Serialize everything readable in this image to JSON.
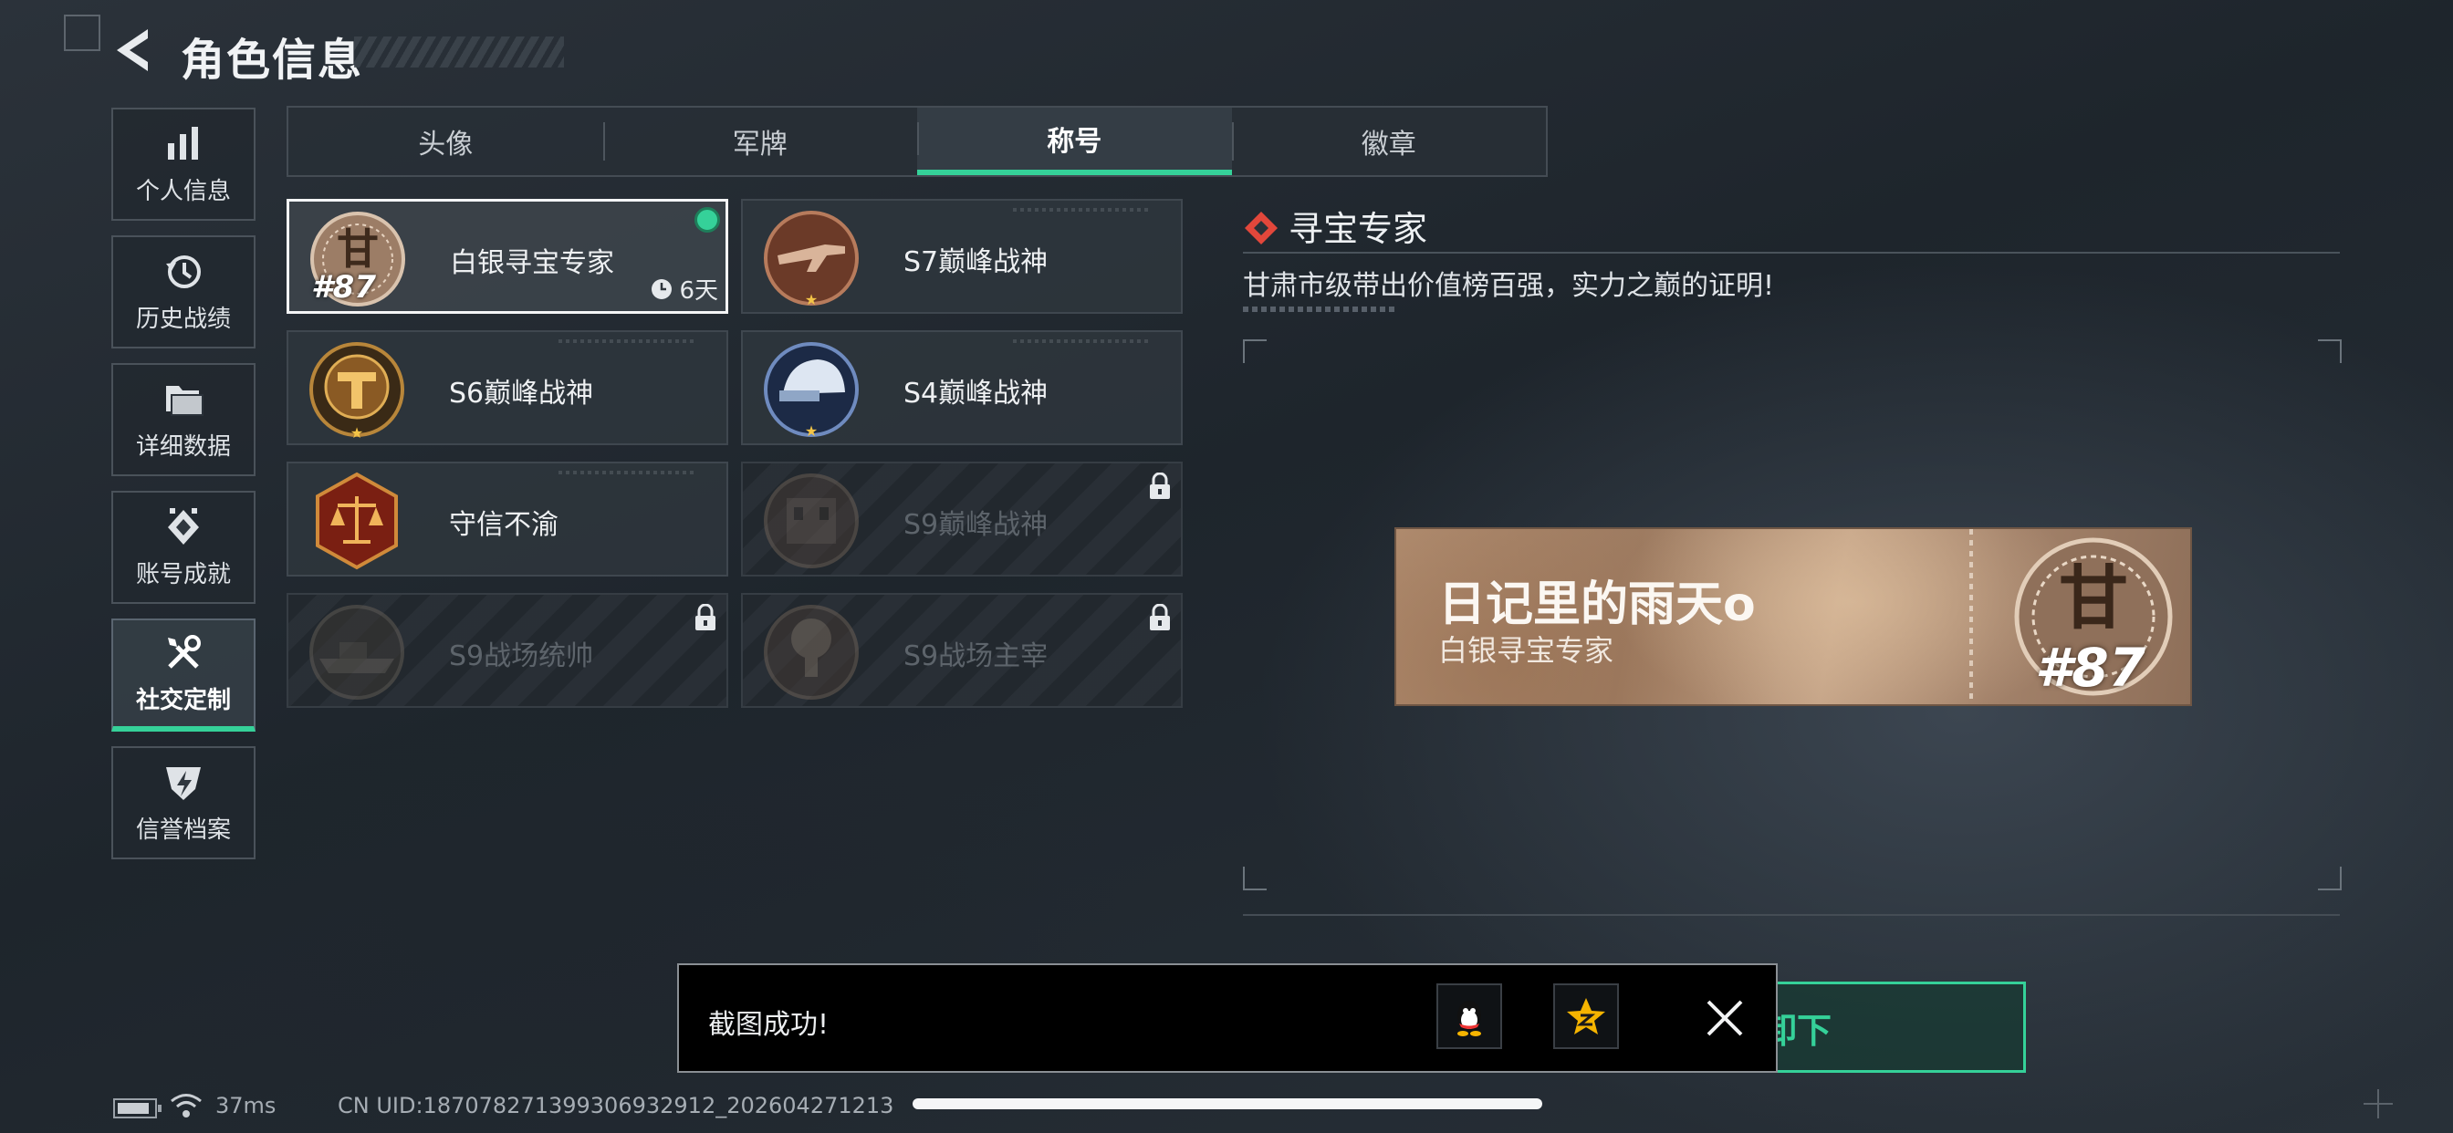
{
  "header": {
    "title": "角色信息"
  },
  "sidebar": {
    "items": [
      {
        "label": "个人信息",
        "icon": "bar-chart-icon",
        "active": false
      },
      {
        "label": "历史战绩",
        "icon": "history-icon",
        "active": false
      },
      {
        "label": "详细数据",
        "icon": "folder-icon",
        "active": false
      },
      {
        "label": "账号成就",
        "icon": "achievement-icon",
        "active": false
      },
      {
        "label": "社交定制",
        "icon": "tools-icon",
        "active": true
      },
      {
        "label": "信誉档案",
        "icon": "credit-shield-icon",
        "active": false
      }
    ]
  },
  "tabs": [
    {
      "label": "头像",
      "active": false
    },
    {
      "label": "军牌",
      "active": false
    },
    {
      "label": "称号",
      "active": true
    },
    {
      "label": "徽章",
      "active": false
    }
  ],
  "titles": [
    {
      "name": "白银寻宝专家",
      "badge": "gan-treasure-badge",
      "rank": "#87",
      "timer": "6天",
      "equipped": true,
      "locked": false
    },
    {
      "name": "S7巅峰战神",
      "badge": "rifle-badge",
      "locked": false
    },
    {
      "name": "S6巅峰战神",
      "badge": "gold-t-badge",
      "locked": false
    },
    {
      "name": "S4巅峰战神",
      "badge": "helmet-badge",
      "locked": false
    },
    {
      "name": "守信不渝",
      "badge": "scales-badge",
      "locked": false
    },
    {
      "name": "S9巅峰战神",
      "badge": "building-badge",
      "locked": true
    },
    {
      "name": "S9战场统帅",
      "badge": "warship-badge",
      "locked": true
    },
    {
      "name": "S9战场主宰",
      "badge": "mushroom-cloud-badge",
      "locked": true
    }
  ],
  "detail": {
    "title": "寻宝专家",
    "description": "甘肃市级带出价值榜百强，实力之巅的证明!",
    "nameplate": {
      "player_name": "日记里的雨天o",
      "title": "白银寻宝专家",
      "rank": "#87"
    }
  },
  "confirm_button": {
    "label": "卸下"
  },
  "toast": {
    "message": "截图成功!",
    "share": [
      "qq-icon",
      "qzone-icon"
    ]
  },
  "footer": {
    "ping": "37ms",
    "uid": "CN UID:187078271399306932912_202604271213"
  },
  "colors": {
    "accent": "#35d199",
    "background": "#232a31",
    "toast_bg": "#000000"
  }
}
